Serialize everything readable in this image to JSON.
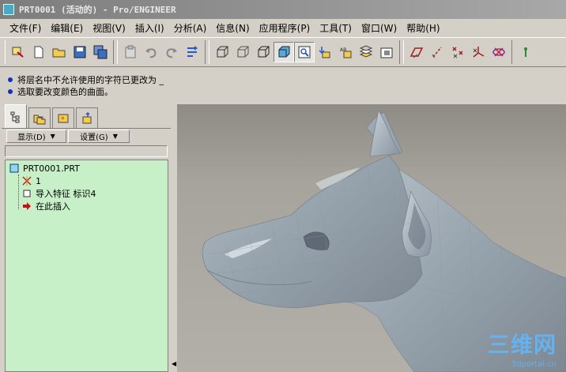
{
  "window": {
    "title": "PRT0001 (活动的) - Pro/ENGINEER"
  },
  "menu": [
    {
      "label": "文件(F)"
    },
    {
      "label": "编辑(E)"
    },
    {
      "label": "视图(V)"
    },
    {
      "label": "插入(I)"
    },
    {
      "label": "分析(A)"
    },
    {
      "label": "信息(N)"
    },
    {
      "label": "应用程序(P)"
    },
    {
      "label": "工具(T)"
    },
    {
      "label": "窗口(W)"
    },
    {
      "label": "帮助(H)"
    }
  ],
  "messages": [
    {
      "text": "将层名中不允许使用的字符已更改为 _"
    },
    {
      "text": "选取要改变颜色的曲面。"
    }
  ],
  "model_tree": {
    "show_label": "显示(D)",
    "settings_label": "设置(G)",
    "root": "PRT0001.PRT",
    "items": [
      {
        "label": "1",
        "icon": "csys-icon"
      },
      {
        "label": "导入特征 标识4",
        "icon": "import-feature-icon"
      },
      {
        "label": "在此插入",
        "icon": "insert-here-arrow-icon"
      }
    ]
  },
  "watermark": {
    "main": "三维网",
    "sub": "3dportal.cn"
  },
  "colors": {
    "tree_bg": "#c8f0c8",
    "model": "#9aa4ae",
    "accent": "#4aa8c8"
  }
}
